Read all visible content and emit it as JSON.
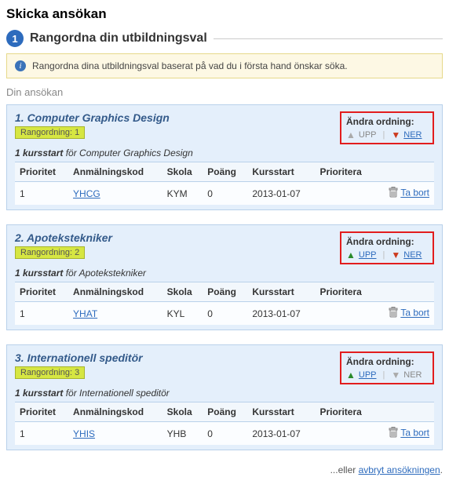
{
  "page": {
    "title": "Skicka ansökan",
    "stepNumber": "1",
    "stepTitle": "Rangordna din utbildningsval",
    "infoText": "Rangordna dina utbildningsval baserat på vad du i första hand önskar söka.",
    "subhead": "Din ansökan",
    "cancelPrefix": "...eller ",
    "cancelLink": "avbryt ansökningen",
    "cancelSuffix": "."
  },
  "labels": {
    "orderTitle": "Ändra ordning:",
    "up": "UPP",
    "down": "NER",
    "rankPrefix": "Rangordning: ",
    "kursstartPrefix": "1 kursstart",
    "for": " för ",
    "taBort": "Ta bort"
  },
  "columns": {
    "prioritet": "Prioritet",
    "kod": "Anmälningskod",
    "skola": "Skola",
    "poang": "Poäng",
    "kursstart": "Kursstart",
    "prioritera": "Prioritera"
  },
  "courses": [
    {
      "title": "1. Computer Graphics Design",
      "rank": "1",
      "name": "Computer Graphics Design",
      "upActive": false,
      "downActive": true,
      "row": {
        "prioritet": "1",
        "kod": "YHCG",
        "skola": "KYM",
        "poang": "0",
        "kursstart": "2013-01-07"
      }
    },
    {
      "title": "2. Apotekstekniker",
      "rank": "2",
      "name": "Apotekstekniker",
      "upActive": true,
      "downActive": true,
      "row": {
        "prioritet": "1",
        "kod": "YHAT",
        "skola": "KYL",
        "poang": "0",
        "kursstart": "2013-01-07"
      }
    },
    {
      "title": "3. Internationell speditör",
      "rank": "3",
      "name": "Internationell speditör",
      "upActive": true,
      "downActive": false,
      "row": {
        "prioritet": "1",
        "kod": "YHIS",
        "skola": "YHB",
        "poang": "0",
        "kursstart": "2013-01-07"
      }
    }
  ]
}
